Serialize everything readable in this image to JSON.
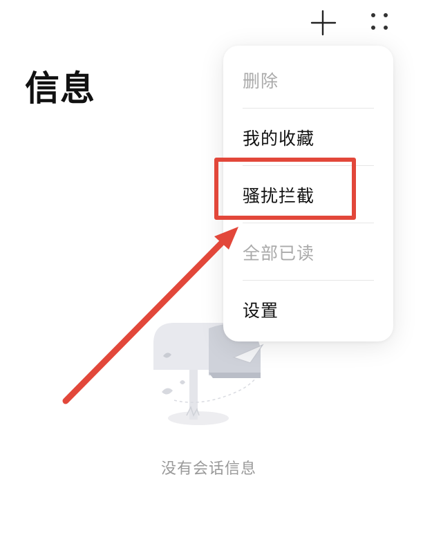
{
  "header": {
    "title": "信息",
    "add_icon": "plus-icon",
    "more_icon": "more-dots-icon"
  },
  "menu": {
    "items": [
      {
        "label": "删除",
        "enabled": false
      },
      {
        "label": "我的收藏",
        "enabled": true
      },
      {
        "label": "骚扰拦截",
        "enabled": true,
        "highlighted": true
      },
      {
        "label": "全部已读",
        "enabled": false
      },
      {
        "label": "设置",
        "enabled": true
      }
    ]
  },
  "empty_state": {
    "text": "没有会话信息",
    "icon": "mailbox-illustration"
  },
  "annotation": {
    "color": "#e2473a"
  }
}
